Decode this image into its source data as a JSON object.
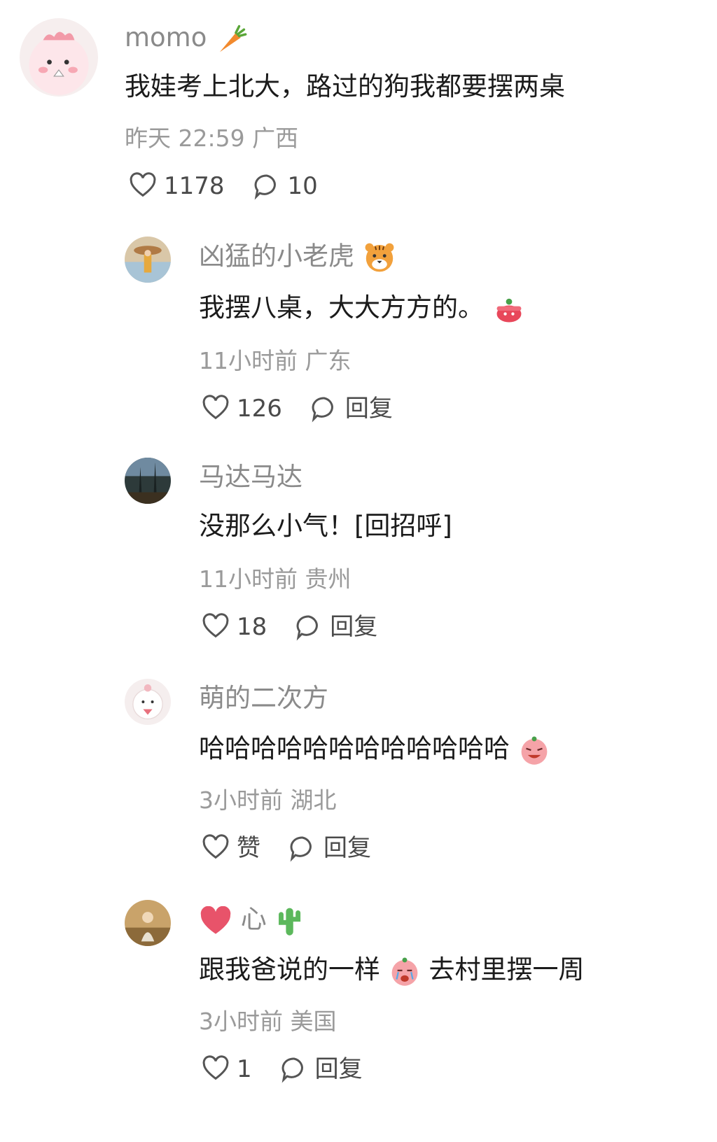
{
  "comments": [
    {
      "username": "momo",
      "name_emoji": "carrot-emoji",
      "text": "我娃考上北大，路过的狗我都要摆两桌",
      "time": "昨天 22:59",
      "location": "广西",
      "likes": "1178",
      "replies": "10"
    },
    {
      "username": "凶猛的小老虎",
      "name_emoji": "tiger-emoji",
      "text": "我摆八桌，大大方方的。",
      "text_emoji": "pot-emoji",
      "time": "11小时前",
      "location": "广东",
      "likes": "126",
      "reply_label": "回复"
    },
    {
      "username": "马达马达",
      "text": "没那么小气！[回招呼]",
      "time": "11小时前",
      "location": "贵州",
      "likes": "18",
      "reply_label": "回复"
    },
    {
      "username": "萌的二次方",
      "text": "哈哈哈哈哈哈哈哈哈哈哈哈",
      "text_emoji": "laughing-crying-emoji",
      "time": "3小时前",
      "location": "湖北",
      "likes": "赞",
      "reply_label": "回复"
    },
    {
      "username_prefix_emoji": "heart-emoji",
      "username": "心",
      "name_emoji": "cactus-emoji",
      "text_part1": "跟我爸说的一样",
      "text_emoji": "crying-emoji",
      "text_part2": "去村里摆一周",
      "time": "3小时前",
      "location": "美国",
      "likes": "1",
      "reply_label": "回复"
    }
  ],
  "colors": {
    "text": "#1b1b1b",
    "muted": "#9a9a9a",
    "name": "#8a8a8a"
  }
}
